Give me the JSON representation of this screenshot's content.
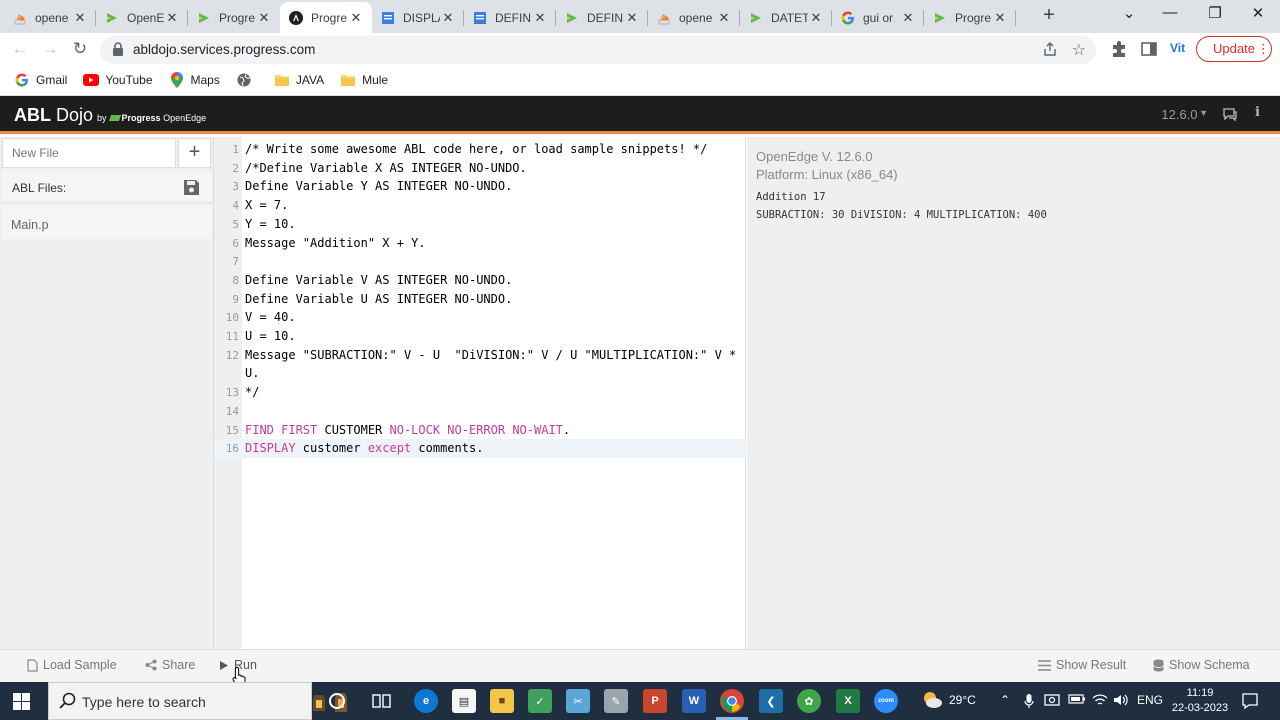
{
  "browser": {
    "tabs": [
      {
        "title": "opene",
        "favicon": "stack-icon",
        "color": "#f48024"
      },
      {
        "title": "OpenE",
        "favicon": "progress-icon",
        "color": "#5fbb46"
      },
      {
        "title": "Progre",
        "favicon": "progress-icon",
        "color": "#5fbb46"
      },
      {
        "title": "Progre",
        "favicon": "angular-icon",
        "color": "#202124",
        "active": true
      },
      {
        "title": "DISPLA",
        "favicon": "docs-icon",
        "color": "#3d7ee1"
      },
      {
        "title": "DEFINE",
        "favicon": "docs-icon",
        "color": "#3d7ee1"
      },
      {
        "title": "DEFINE",
        "favicon": "progress-icon",
        "color": "#5fbb46"
      },
      {
        "title": "opene",
        "favicon": "stack-icon",
        "color": "#f48024"
      },
      {
        "title": "DATET",
        "favicon": "progress-icon",
        "color": "#5fbb46"
      },
      {
        "title": "gui or",
        "favicon": "google-icon",
        "color": "#4285f4"
      },
      {
        "title": "Progre",
        "favicon": "progress-icon",
        "color": "#5fbb46"
      }
    ],
    "url": "abldojo.services.progress.com",
    "profile_label": "Vit",
    "update_label": "Update",
    "bookmarks": [
      {
        "label": "Gmail",
        "icon": "google-icon"
      },
      {
        "label": "YouTube",
        "icon": "youtube-icon"
      },
      {
        "label": "Maps",
        "icon": "maps-icon"
      },
      {
        "label": "",
        "icon": "globe-icon"
      },
      {
        "label": "JAVA",
        "icon": "folder-icon"
      },
      {
        "label": "Mule",
        "icon": "folder-icon"
      }
    ]
  },
  "app": {
    "brand_abl": "ABL",
    "brand_dojo": "Dojo",
    "brand_by": "by",
    "brand_progress": "Progress",
    "brand_openedge": "OpenEdge",
    "version": "12.6.0",
    "accent_color": "#ed8b3b"
  },
  "sidebar": {
    "new_file_placeholder": "New File",
    "files_label": "ABL Files:",
    "files": [
      "Main.p"
    ]
  },
  "editor": {
    "lines": [
      {
        "n": "1",
        "segments": [
          {
            "t": "/* Write some awesome ABL code here, or load sample snippets! */",
            "c": ""
          }
        ]
      },
      {
        "n": "2",
        "segments": [
          {
            "t": "/*Define Variable X AS INTEGER NO-UNDO.",
            "c": ""
          }
        ]
      },
      {
        "n": "3",
        "segments": [
          {
            "t": "Define Variable Y AS INTEGER NO-UNDO.",
            "c": ""
          }
        ]
      },
      {
        "n": "4",
        "segments": [
          {
            "t": "X = 7.",
            "c": ""
          }
        ]
      },
      {
        "n": "5",
        "segments": [
          {
            "t": "Y = 10.",
            "c": ""
          }
        ]
      },
      {
        "n": "6",
        "segments": [
          {
            "t": "Message \"Addition\" X + Y.",
            "c": ""
          }
        ]
      },
      {
        "n": "7",
        "segments": [
          {
            "t": "",
            "c": ""
          }
        ]
      },
      {
        "n": "8",
        "segments": [
          {
            "t": "Define Variable V AS INTEGER NO-UNDO.",
            "c": ""
          }
        ]
      },
      {
        "n": "9",
        "segments": [
          {
            "t": "Define Variable U AS INTEGER NO-UNDO.",
            "c": ""
          }
        ]
      },
      {
        "n": "10",
        "segments": [
          {
            "t": "V = 40.",
            "c": ""
          }
        ]
      },
      {
        "n": "11",
        "segments": [
          {
            "t": "U = 10.",
            "c": ""
          }
        ]
      },
      {
        "n": "12",
        "segments": [
          {
            "t": "Message \"SUBRACTION:\" V - U  \"DiVISION:\" V / U \"MULTIPLICATION:\" V *",
            "c": ""
          }
        ]
      },
      {
        "n": "",
        "segments": [
          {
            "t": "U.",
            "c": ""
          }
        ]
      },
      {
        "n": "13",
        "segments": [
          {
            "t": "*/",
            "c": ""
          }
        ]
      },
      {
        "n": "14",
        "segments": [
          {
            "t": "",
            "c": ""
          }
        ]
      },
      {
        "n": "15",
        "segments": [
          {
            "t": "FIND FIRST",
            "c": "kw"
          },
          {
            "t": " CUSTOMER ",
            "c": ""
          },
          {
            "t": "NO-LOCK NO-ERROR NO-WAIT",
            "c": "kw"
          },
          {
            "t": ".",
            "c": ""
          }
        ]
      },
      {
        "n": "16",
        "current": true,
        "segments": [
          {
            "t": "DISPLAY",
            "c": "kw"
          },
          {
            "t": " customer ",
            "c": ""
          },
          {
            "t": "except",
            "c": "kw"
          },
          {
            "t": " comments.",
            "c": ""
          }
        ]
      }
    ]
  },
  "output": {
    "version_line": "OpenEdge V. 12.6.0",
    "platform_line": "Platform: Linux (x86_64)",
    "lines": [
      "Addition 17",
      "SUBRACTION: 30 DiVISION: 4 MULTIPLICATION: 400"
    ]
  },
  "footer": {
    "load_sample": "Load Sample",
    "share": "Share",
    "run": "Run",
    "show_result": "Show Result",
    "show_schema": "Show Schema"
  },
  "taskbar": {
    "search_placeholder": "Type here to search",
    "weather": "29°C",
    "language": "ENG",
    "time": "11:19",
    "date": "22-03-2023"
  }
}
